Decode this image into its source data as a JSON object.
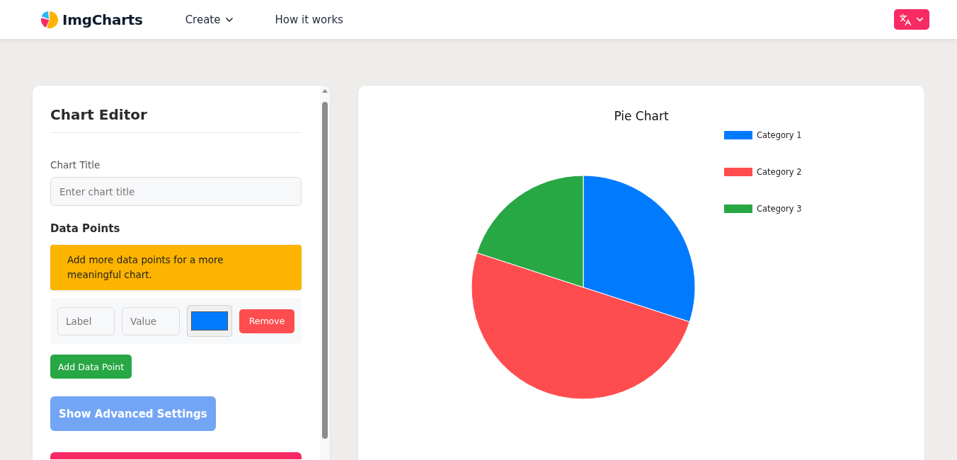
{
  "header": {
    "logo": "ImgCharts",
    "nav": [
      {
        "label": "Create",
        "kind": "dropdown"
      },
      {
        "label": "How it works",
        "kind": "link"
      }
    ]
  },
  "editor": {
    "title": "Chart Editor",
    "chart_title": {
      "label": "Chart Title",
      "placeholder": "Enter chart title"
    },
    "data_points_heading": "Data Points",
    "warning": "Add more data points for a more meaningful chart.",
    "data_points": [
      {
        "label_placeholder": "Label",
        "value_placeholder": "Value",
        "color": "#007bff",
        "remove": "Remove"
      }
    ],
    "add_button": "Add Data Point",
    "advanced_button": "Show Advanced Settings"
  },
  "chart": {
    "title": "Pie Chart",
    "legend": [
      {
        "label": "Category 1",
        "color": "#007bff"
      },
      {
        "label": "Category 2",
        "color": "#ff4d4f"
      },
      {
        "label": "Category 3",
        "color": "#28a745"
      }
    ]
  }
}
